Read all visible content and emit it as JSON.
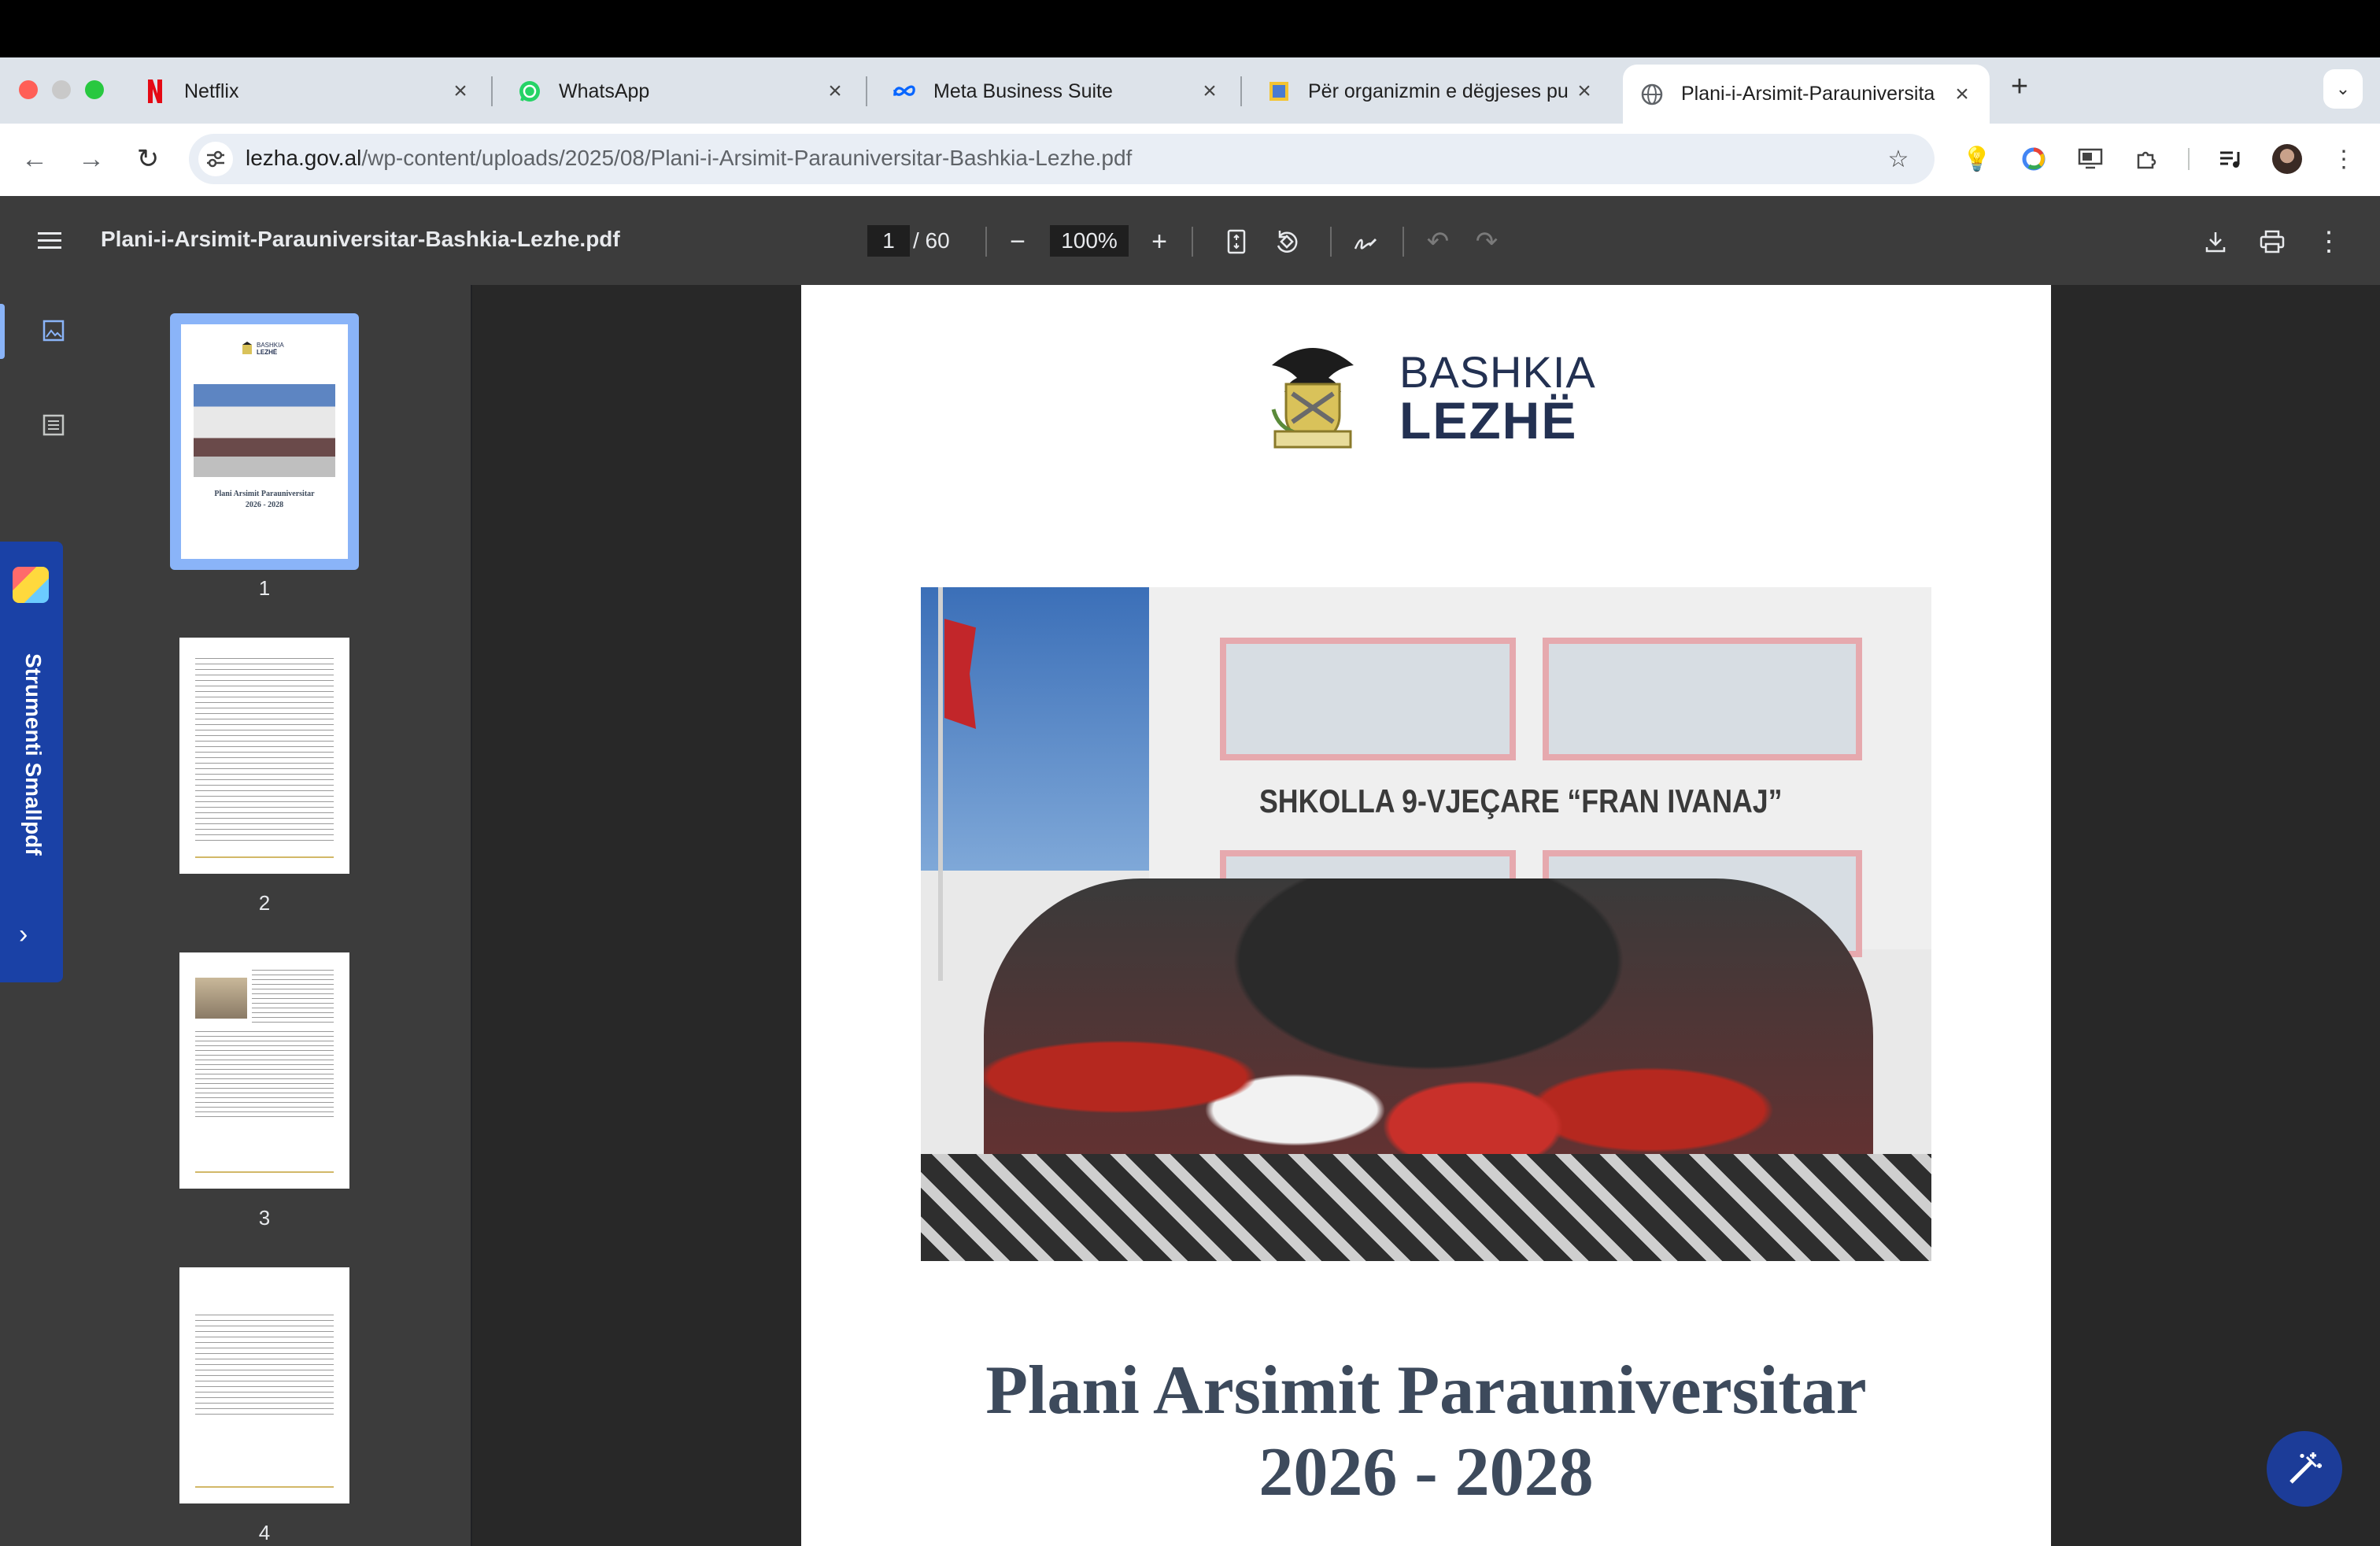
{
  "browser": {
    "tabs": [
      {
        "title": "Netflix",
        "icon": "netflix-icon"
      },
      {
        "title": "WhatsApp",
        "icon": "whatsapp-icon"
      },
      {
        "title": "Meta Business Suite",
        "icon": "meta-icon"
      },
      {
        "title": "Për organizmin e dëgjeses pu",
        "icon": "document-icon"
      },
      {
        "title": "Plani-i-Arsimit-Parauniversita",
        "icon": "globe-icon",
        "active": true
      }
    ],
    "new_tab": "+",
    "url_host": "lezha.gov.al",
    "url_path": "/wp-content/uploads/2025/08/Plani-i-Arsimit-Parauniversitar-Bashkia-Lezhe.pdf"
  },
  "pdf_toolbar": {
    "filename": "Plani-i-Arsimit-Parauniversitar-Bashkia-Lezhe.pdf",
    "current_page": "1",
    "total_pages": "/ 60",
    "zoom": "100%"
  },
  "sidebar": {
    "thumbnails": [
      {
        "number": "1"
      },
      {
        "number": "2"
      },
      {
        "number": "3"
      },
      {
        "number": "4"
      }
    ],
    "thumb1_title": "Plani Arsimit Parauniversitar",
    "thumb1_years": "2026 - 2028",
    "thumb1_logo_line1": "BASHKIA",
    "thumb1_logo_line2": "LEZHË"
  },
  "smallpdf": {
    "label": "Strumenti Smallpdf"
  },
  "document": {
    "logo_line1": "BASHKIA",
    "logo_line2": "LEZHË",
    "school_sign": "SHKOLLA 9-VJEÇARE “FRAN IVANAJ”",
    "title_line1": "Plani Arsimit Parauniversitar",
    "title_line2": "2026 - 2028"
  },
  "colors": {
    "title": "#3d4a5c",
    "logo_navy": "#233152",
    "active_thumb_border": "#8ab4f8",
    "smallpdf_blue": "#1a41a6",
    "fab_blue": "#1c3c98"
  }
}
